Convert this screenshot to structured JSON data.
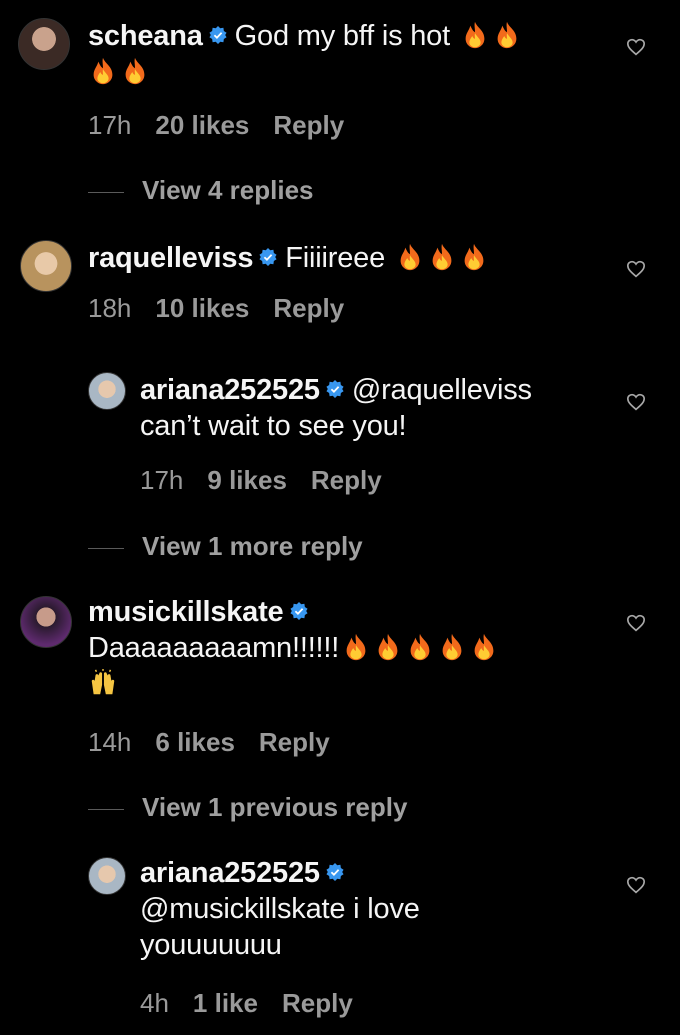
{
  "comments": [
    {
      "user": "scheana",
      "text": "God my bff is hot",
      "time": "17h",
      "likes": "20 likes",
      "reply": "Reply"
    },
    {
      "user": "raquelleviss",
      "text": "Fiiiireee",
      "time": "18h",
      "likes": "10 likes",
      "reply": "Reply"
    },
    {
      "user": "ariana252525",
      "text": "@raquelleviss",
      "text2": "can’t wait to see you!",
      "time": "17h",
      "likes": "9 likes",
      "reply": "Reply"
    },
    {
      "user": "musickillskate",
      "text": "Daaaaaaaaamn!!!!!!",
      "time": "14h",
      "likes": "6 likes",
      "reply": "Reply"
    },
    {
      "user": "ariana252525",
      "text": "@musickillskate i love",
      "text2": "youuuuuuu",
      "time": "4h",
      "likes": "1 like",
      "reply": "Reply"
    }
  ],
  "view_replies": [
    "View 4 replies",
    "View 1 more reply",
    "View 1 previous reply"
  ],
  "icons": {
    "verified": "verified-badge-icon",
    "fire": "fire-emoji-icon",
    "hands": "raised-hands-emoji-icon",
    "heart": "heart-outline-icon"
  },
  "colors": {
    "background": "#000000",
    "verified": "#3897f0",
    "meta": "#9a9a9a"
  }
}
